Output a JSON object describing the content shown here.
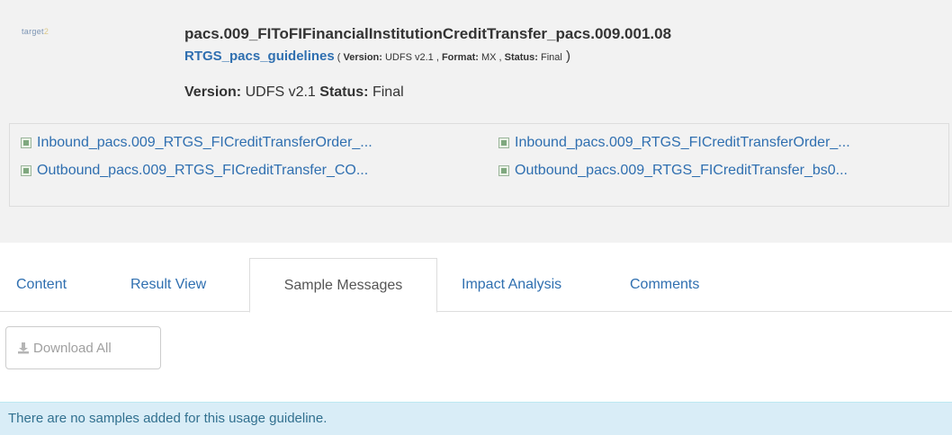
{
  "header": {
    "logo_text": "target",
    "logo_mark": "2",
    "title": "pacs.009_FIToFIFinancialInstitutionCreditTransfer_pacs.009.001.08",
    "guideline_link": "RTGS_pacs_guidelines",
    "meta_open": " ( ",
    "meta_version_label": "Version:",
    "meta_version_value": " UDFS v2.1 , ",
    "meta_format_label": "Format:",
    "meta_format_value": " MX , ",
    "meta_status_label": "Status:",
    "meta_status_value": " Final",
    "meta_close": " )",
    "version_label": "Version:",
    "version_value": " UDFS v2.1 ",
    "status_label": "Status:",
    "status_value": " Final"
  },
  "files": [
    "Inbound_pacs.009_RTGS_FICreditTransferOrder_...",
    "Inbound_pacs.009_RTGS_FICreditTransferOrder_...",
    "Outbound_pacs.009_RTGS_FICreditTransfer_CO...",
    "Outbound_pacs.009_RTGS_FICreditTransfer_bs0..."
  ],
  "tabs": [
    {
      "label": "Content"
    },
    {
      "label": "Result View"
    },
    {
      "label": "Sample Messages",
      "active": true
    },
    {
      "label": "Impact Analysis"
    },
    {
      "label": "Comments"
    }
  ],
  "toolbar": {
    "download_all_label": "Download All",
    "download_icon": "download-icon"
  },
  "info": {
    "message": "There are no samples added for this usage guideline."
  },
  "colors": {
    "link": "#2f6fb0",
    "panel_bg": "#f2f2f2",
    "info_bg": "#d9edf7",
    "info_text": "#31708f"
  }
}
